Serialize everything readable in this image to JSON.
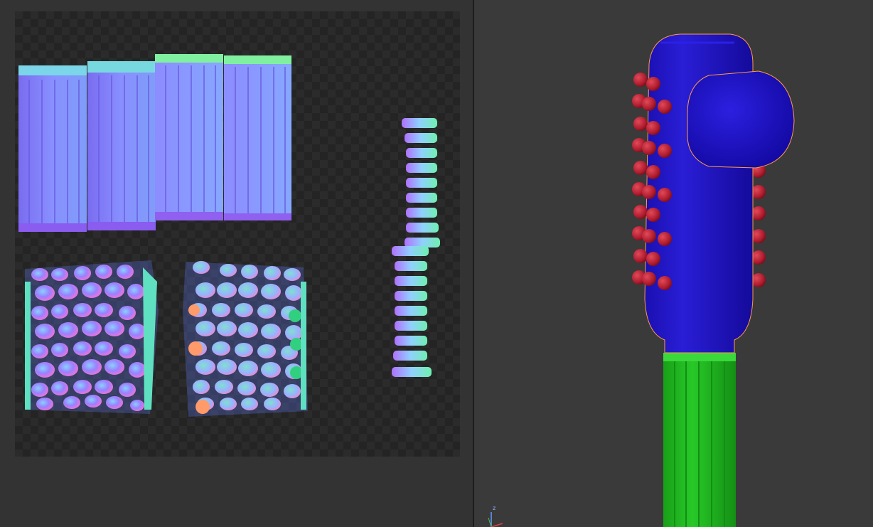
{
  "uv_editor": {
    "texture": "normal-map",
    "checker_background": true
  },
  "viewport": {
    "object": "handle-model",
    "colors": {
      "head": "#1a0fc0",
      "bumps": "#b01c2e",
      "grip": "#1fb51f"
    },
    "axis_gizmo": {
      "z_label": "z"
    }
  }
}
